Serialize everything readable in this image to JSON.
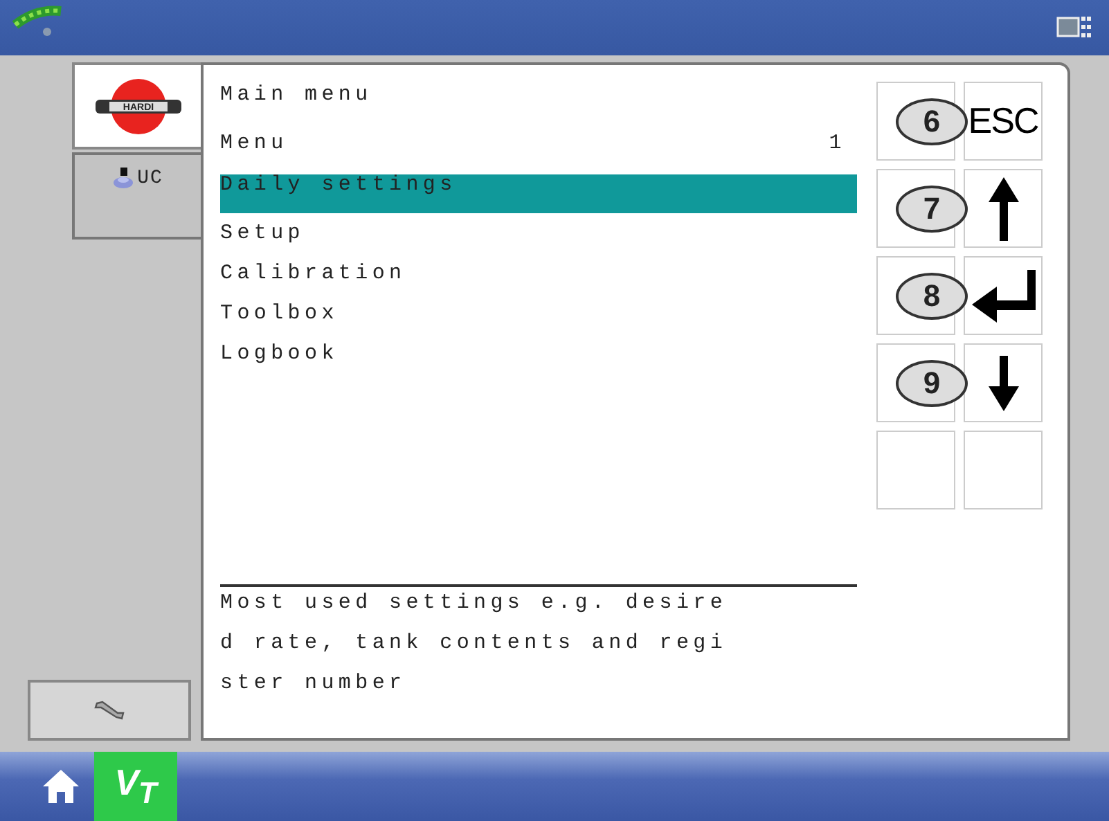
{
  "tabs": [
    {
      "kind": "logo",
      "label": "HARDI",
      "selected": true
    },
    {
      "kind": "uc",
      "label": "UC",
      "selected": false
    }
  ],
  "menu": {
    "title": "Main menu",
    "subtitle": "Menu",
    "page": "1",
    "items": [
      {
        "label": "Daily settings",
        "selected": true
      },
      {
        "label": "Setup",
        "selected": false
      },
      {
        "label": "Calibration",
        "selected": false
      },
      {
        "label": "Toolbox",
        "selected": false
      },
      {
        "label": "Logbook",
        "selected": false
      }
    ],
    "description_lines": [
      "Most used settings e.g. desire",
      "d rate, tank contents and regi",
      "ster number"
    ]
  },
  "soft_keys": [
    {
      "kind": "esc",
      "number": "6",
      "label": "ESC"
    },
    {
      "kind": "up",
      "number": "7"
    },
    {
      "kind": "enter",
      "number": "8"
    },
    {
      "kind": "down",
      "number": "9"
    },
    {
      "kind": "empty"
    }
  ],
  "taskbar": [
    {
      "kind": "home",
      "selected": false
    },
    {
      "kind": "vt",
      "label": "V$_{T}$",
      "selected": true
    }
  ]
}
